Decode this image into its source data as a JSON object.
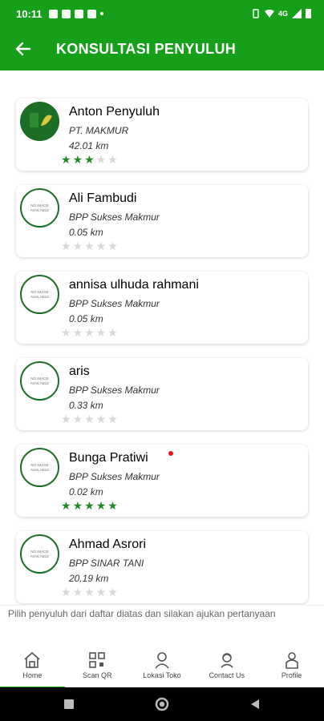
{
  "status_bar": {
    "time": "10:11",
    "network": "4G"
  },
  "app_bar": {
    "title": "KONSULTASI PENYULUH"
  },
  "no_image_text": "NO IMAGE AVAILABLE",
  "consultants": [
    {
      "name": "Anton Penyuluh",
      "org": "PT. MAKMUR",
      "distance": "42.01 km",
      "rating": 3,
      "has_photo": true,
      "new": false
    },
    {
      "name": "Ali Fambudi",
      "org": "BPP Sukses Makmur",
      "distance": "0.05 km",
      "rating": 0,
      "has_photo": false,
      "new": false
    },
    {
      "name": "annisa ulhuda rahmani",
      "org": "BPP Sukses Makmur",
      "distance": "0.05 km",
      "rating": 0,
      "has_photo": false,
      "new": false
    },
    {
      "name": "aris",
      "org": "BPP Sukses Makmur",
      "distance": "0.33 km",
      "rating": 0,
      "has_photo": false,
      "new": false
    },
    {
      "name": "Bunga Pratiwi",
      "org": "BPP Sukses Makmur",
      "distance": "0.02 km",
      "rating": 5,
      "has_photo": false,
      "new": true
    },
    {
      "name": "Ahmad Asrori",
      "org": "BPP SINAR TANI",
      "distance": "20.19 km",
      "rating": 0,
      "has_photo": false,
      "new": false
    }
  ],
  "hint": "Pilih penyuluh dari daftar diatas dan silakan ajukan pertanyaan",
  "bottom_nav": [
    {
      "label": "Home",
      "icon": "home-icon",
      "active": true
    },
    {
      "label": "Scan QR",
      "icon": "qr-icon",
      "active": false
    },
    {
      "label": "Lokasi Toko",
      "icon": "store-location-icon",
      "active": false
    },
    {
      "label": "Contact Us",
      "icon": "contact-icon",
      "active": false
    },
    {
      "label": "Profile",
      "icon": "profile-icon",
      "active": false
    }
  ],
  "colors": {
    "primary": "#16a019",
    "star_on": "#1d8a23",
    "star_off": "#d8d8d8",
    "dot": "#e21b1b"
  }
}
